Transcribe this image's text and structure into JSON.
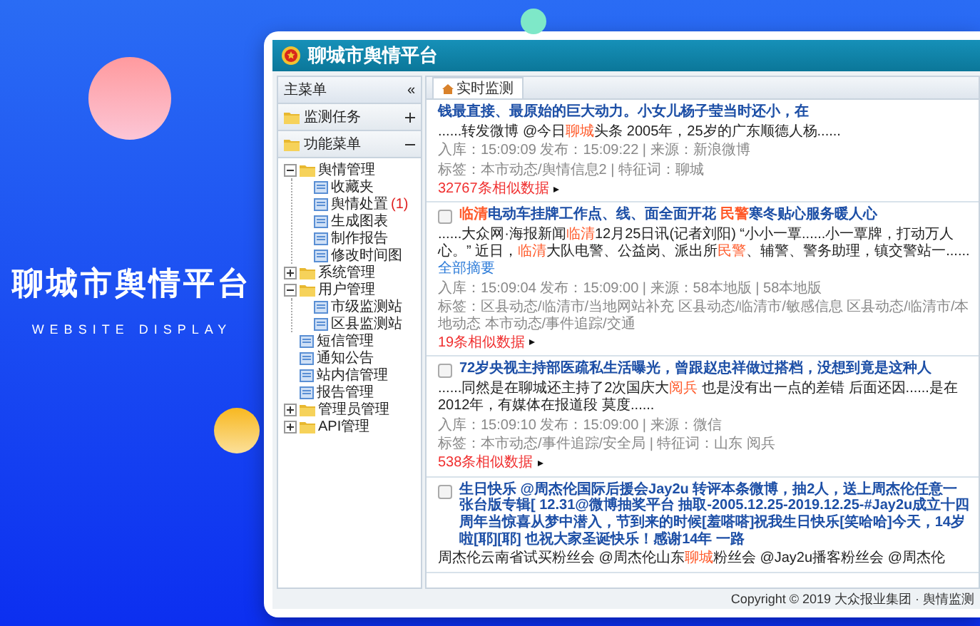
{
  "hero": {
    "title": "聊城市舆情平台",
    "subtitle": "WEBSITE DISPLAY"
  },
  "app": {
    "title": "聊城市舆情平台"
  },
  "sidebar": {
    "title": "主菜单",
    "collapse": "«",
    "sections": [
      {
        "label": "监测任务",
        "expanded": false
      },
      {
        "label": "功能菜单",
        "expanded": true,
        "tree": [
          {
            "label": "舆情管理",
            "kind": "folder",
            "expanded": true,
            "children": [
              {
                "label": "收藏夹",
                "kind": "page"
              },
              {
                "label": "舆情处置",
                "kind": "page",
                "badge": "(1)"
              },
              {
                "label": "生成图表",
                "kind": "page"
              },
              {
                "label": "制作报告",
                "kind": "page"
              },
              {
                "label": "修改时间图",
                "kind": "page"
              }
            ]
          },
          {
            "label": "系统管理",
            "kind": "folder",
            "expanded": false
          },
          {
            "label": "用户管理",
            "kind": "folder",
            "expanded": true,
            "children": [
              {
                "label": "市级监测站",
                "kind": "page"
              },
              {
                "label": "区县监测站",
                "kind": "page"
              }
            ]
          },
          {
            "label": "短信管理",
            "kind": "page"
          },
          {
            "label": "通知公告",
            "kind": "page"
          },
          {
            "label": "站内信管理",
            "kind": "page"
          },
          {
            "label": "报告管理",
            "kind": "page"
          },
          {
            "label": "管理员管理",
            "kind": "folder",
            "expanded": false
          },
          {
            "label": "API管理",
            "kind": "folder",
            "expanded": false
          }
        ]
      }
    ]
  },
  "tabs": [
    {
      "label": "实时监测",
      "selected": true
    }
  ],
  "news": [
    {
      "title": [
        {
          "text": "钱最直接、最原始的巨大动力。小女儿杨子莹当时还小，在",
          "highlight": false
        }
      ],
      "snippet": [
        {
          "text": "......转发微博 @今日",
          "highlight": false
        },
        {
          "text": "聊城",
          "highlight": true
        },
        {
          "text": "头条 2005年，25岁的广东顺德人杨......",
          "highlight": false
        }
      ],
      "meta": [
        "入库：15:09:09 发布：15:09:22 | 来源：新浪微博",
        "标签：本市动态/舆情信息2 | 特征词：聊城"
      ],
      "similar": "32767条相似数据"
    },
    {
      "checked": false,
      "title": [
        {
          "text": "临清",
          "highlight": true
        },
        {
          "text": "电动车挂牌工作点、线、面全面开花 ",
          "highlight": false
        },
        {
          "text": "民警",
          "highlight": true
        },
        {
          "text": "寒冬贴心服务暖人心",
          "highlight": false
        }
      ],
      "snippet": [
        {
          "text": "......大众网·海报新闻",
          "highlight": false
        },
        {
          "text": "临清",
          "highlight": true
        },
        {
          "text": "12月25日讯(记者刘阳) “小小一覃......小一覃牌，打动万人心。” 近日，",
          "highlight": false
        },
        {
          "text": "临清",
          "highlight": true
        },
        {
          "text": "大队电警、公益岗、派出所",
          "highlight": false
        },
        {
          "text": "民警",
          "highlight": true
        },
        {
          "text": "、辅警、警务助理，镇交警站一......",
          "highlight": false
        }
      ],
      "more": "全部摘要",
      "meta": [
        "入库：15:09:04 发布：15:09:00 | 来源：58本地版 | 58本地版",
        "标签：区县动态/临清市/当地网站补充 区县动态/临清市/敏感信息 区县动态/临清市/本地动态 本市动态/事件追踪/交通"
      ],
      "similar": "19条相似数据"
    },
    {
      "checked": false,
      "title": [
        {
          "text": "72岁央视主持部医疏私生活曝光，曾跟赵忠祥做过搭档，没想到竟是这种人",
          "highlight": false
        }
      ],
      "snippet": [
        {
          "text": "......同然是在聊城还主持了2次国庆大",
          "highlight": false
        },
        {
          "text": "阅兵",
          "highlight": true
        },
        {
          "text": " 也是没有出一点的差错 后面还因......是在2012年，有媒体在报道段 莫度......",
          "highlight": false
        }
      ],
      "meta": [
        "入库：15:09:10 发布：15:09:00 | 来源：微信",
        "标签：本市动态/事件追踪/安全局 | 特征词：山东 阅兵"
      ],
      "similar": "538条相似数据"
    },
    {
      "checked": false,
      "title": [
        {
          "text": "生日快乐 @周杰伦国际后援会Jay2u 转评本条微博，抽2人，送上周杰伦任意一张台版专辑[ 12.31@微博抽奖平台 抽取-2005.12.25-2019.12.25-#Jay2u成立十四周年当惊喜从梦中潜入，节到来的时候[羞嗒嗒]祝我生日快乐[笑哈哈]今天，14岁啦[耶][耶] 也祝大家圣诞快乐！感谢14年 一路",
          "highlight": false
        }
      ],
      "snippet": [
        {
          "text": "周杰伦云南省试买粉丝会 @周杰伦山东",
          "highlight": false
        },
        {
          "text": "聊城",
          "highlight": true
        },
        {
          "text": "粉丝会 @Jay2u播客粉丝会 @周杰伦",
          "highlight": false
        }
      ]
    }
  ],
  "footer": "Copyright © 2019 大众报业集团 · 舆情监测"
}
